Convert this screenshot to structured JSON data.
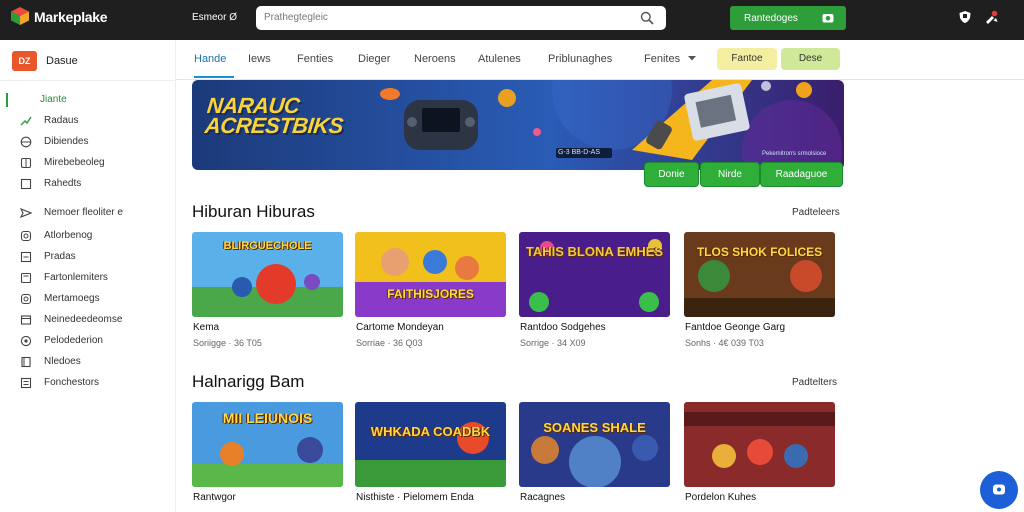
{
  "topbar": {
    "brand": "Markeplake",
    "browse_label": "Esmeor Ø",
    "search_placeholder": "Prathegtegleic",
    "cta_label": "Rantedoges",
    "colors": {
      "bg": "#1f1f1f",
      "cta": "#2e9e3a"
    }
  },
  "sidebar": {
    "badge": "DZ",
    "title": "Dasue",
    "items": [
      {
        "label": "Jiante",
        "icon": "home-icon",
        "active": true
      },
      {
        "label": "Radaus",
        "icon": "trending-icon",
        "active": false
      },
      {
        "label": "Dibiendes",
        "icon": "globe-icon",
        "active": false
      },
      {
        "label": "Mirebebeoleg",
        "icon": "grid-icon",
        "active": false
      },
      {
        "label": "Rahedts",
        "icon": "square-icon",
        "active": false
      },
      {
        "label": "Nemoer fleoliter e",
        "icon": "send-icon",
        "active": false
      },
      {
        "label": "Atlorbenog",
        "icon": "instagram-icon",
        "active": false
      },
      {
        "label": "Pradas",
        "icon": "tag-icon",
        "active": false
      },
      {
        "label": "Fartonlemiters",
        "icon": "filter-icon",
        "active": false
      },
      {
        "label": "Mertamoegs",
        "icon": "instagram-icon",
        "active": false
      },
      {
        "label": "Neinedeedeomse",
        "icon": "box-icon",
        "active": false
      },
      {
        "label": "Pelodederion",
        "icon": "settings-icon",
        "active": false
      },
      {
        "label": "Nledoes",
        "icon": "book-icon",
        "active": false
      },
      {
        "label": "Fonchestors",
        "icon": "list-icon",
        "active": false
      }
    ]
  },
  "tabs": {
    "items": [
      "Hande",
      "Iews",
      "Fenties",
      "Dieger",
      "Neroens",
      "Atulenes",
      "Priblunaghes",
      "Fenites"
    ],
    "pills": [
      "Fantoe",
      "Dese"
    ]
  },
  "banner": {
    "headline_line1": "NARAUC",
    "headline_line2": "ACRESTBIKS",
    "fine_print": "Pekemitrorrs srmolsioce",
    "strip_text": "G-3 BB-D-AS",
    "buttons": [
      "Donie",
      "Nirde",
      "Raadaguoe"
    ]
  },
  "sections": [
    {
      "title": "Hiburan Hiburas",
      "link": "Padteleers",
      "cards": [
        {
          "title": "Kema",
          "meta": "Soriigge · 36 T05",
          "art": "BLIRGUECHOLE"
        },
        {
          "title": "Cartome Mondeyan",
          "meta": "Sorriae · 36 Q03",
          "art": "FAITHISJORES"
        },
        {
          "title": "Rantdoo Sodgehes",
          "meta": "Sorrige · 34 X09",
          "art": "TAHIS BLONA EMHES"
        },
        {
          "title": "Fantdoe Geonge Garg",
          "meta": "Sonhs · 4€ 039 T03",
          "art": "TLOS SHOK FOLICES"
        }
      ]
    },
    {
      "title": "Halnarigg Bam",
      "link": "Padtelters",
      "cards": [
        {
          "title": "Rantwgor",
          "meta": "",
          "art": "MII LEIUNOIS"
        },
        {
          "title": "Nisthiste · Pielomem Enda",
          "meta": "",
          "art": "WHKADA COADBK"
        },
        {
          "title": "Racagnes",
          "meta": "",
          "art": "SOANES SHALE"
        },
        {
          "title": "Pordelon Kuhes",
          "meta": "",
          "art": ""
        }
      ]
    }
  ]
}
